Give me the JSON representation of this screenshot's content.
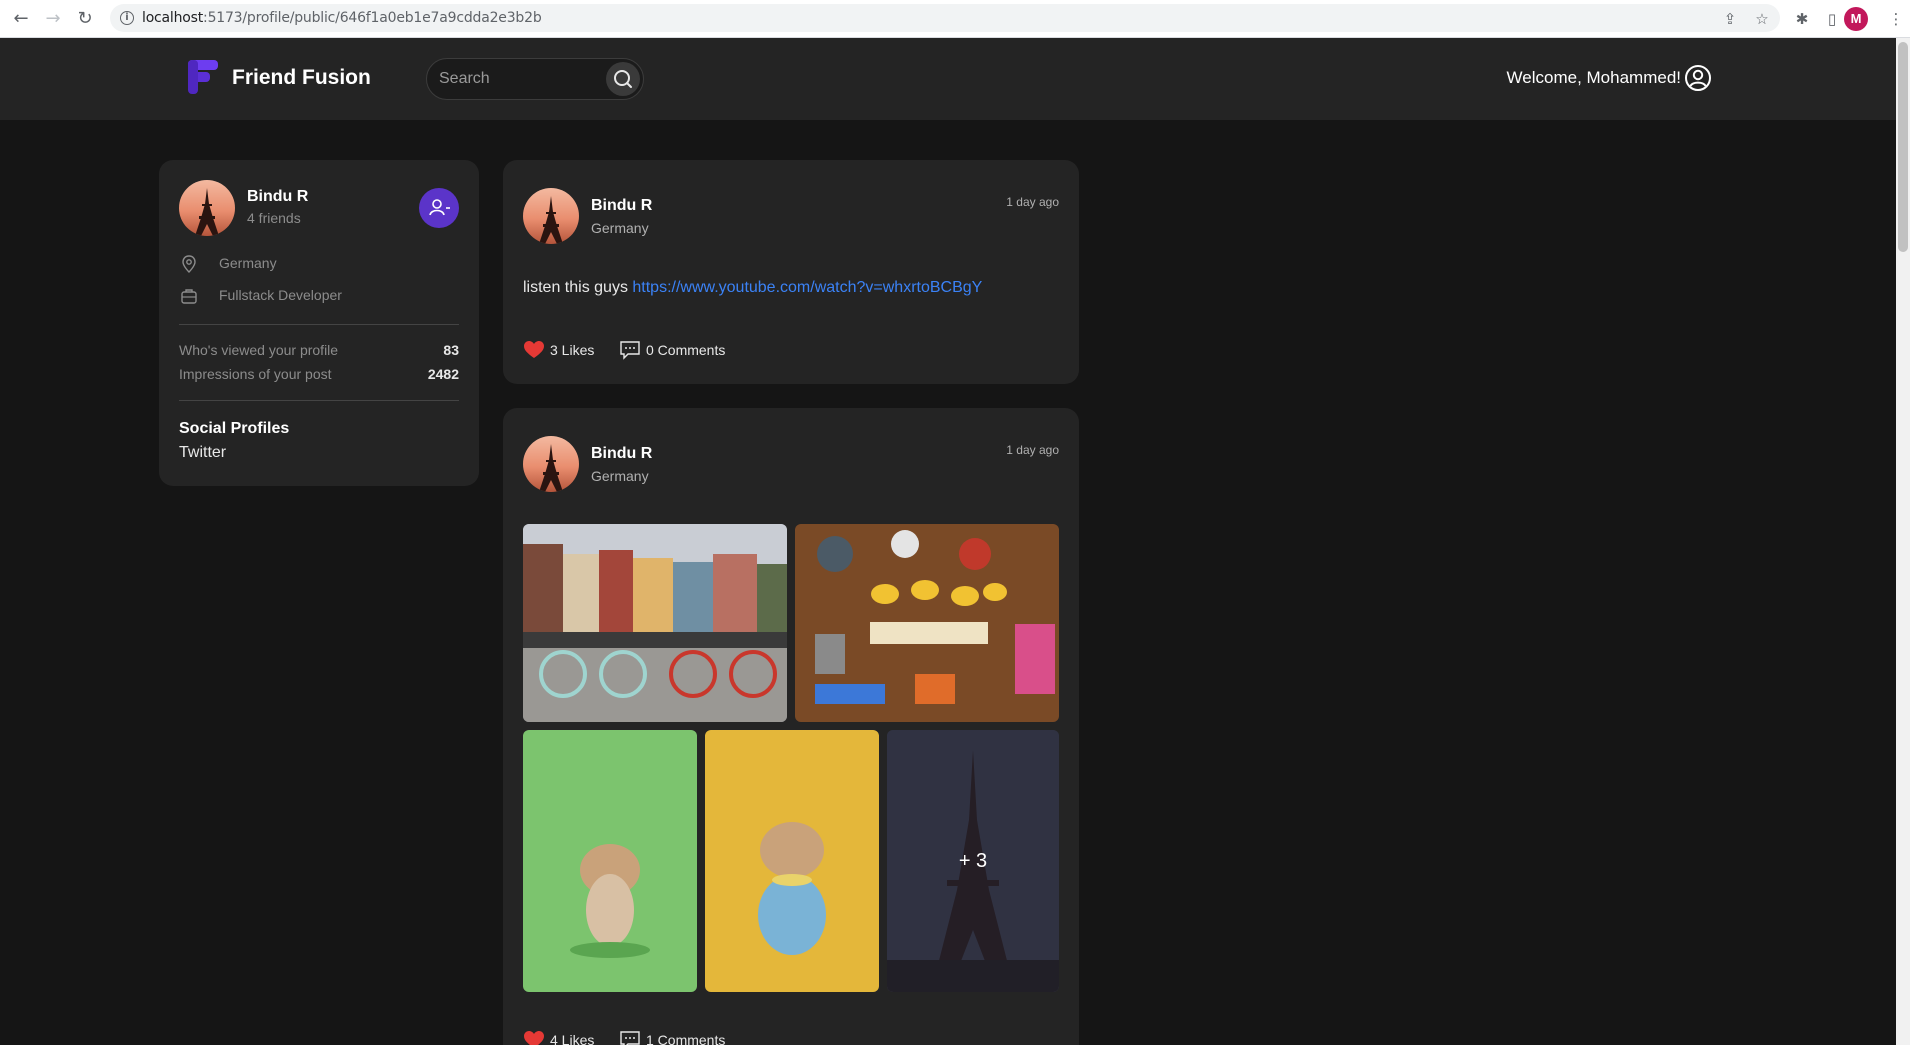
{
  "browser": {
    "url_host": "localhost",
    "url_path": ":5173/profile/public/646f1a0eb1e7a9cdda2e3b2b",
    "profile_initial": "M"
  },
  "header": {
    "brand": "Friend Fusion",
    "search_placeholder": "Search",
    "welcome": "Welcome, Mohammed!"
  },
  "profile": {
    "name": "Bindu R",
    "friends": "4 friends",
    "location": "Germany",
    "occupation": "Fullstack Developer",
    "stats": [
      {
        "label": "Who's viewed your profile",
        "value": "83"
      },
      {
        "label": "Impressions of your post",
        "value": "2482"
      }
    ],
    "social_title": "Social Profiles",
    "social_links": [
      "Twitter"
    ]
  },
  "posts": [
    {
      "name": "Bindu R",
      "location": "Germany",
      "time": "1 day ago",
      "text": "listen this guys ",
      "link": "https://www.youtube.com/watch?v=whxrtoBCBgY",
      "likes": "3 Likes",
      "comments": "0 Comments"
    },
    {
      "name": "Bindu R",
      "location": "Germany",
      "time": "1 day ago",
      "more_images": "+ 3",
      "likes": "4 Likes",
      "comments": "1 Comments"
    }
  ],
  "colors": {
    "accent": "#5b34c9",
    "link": "#3b82f6",
    "like": "#e53935",
    "card": "#242424",
    "background": "#151515"
  }
}
